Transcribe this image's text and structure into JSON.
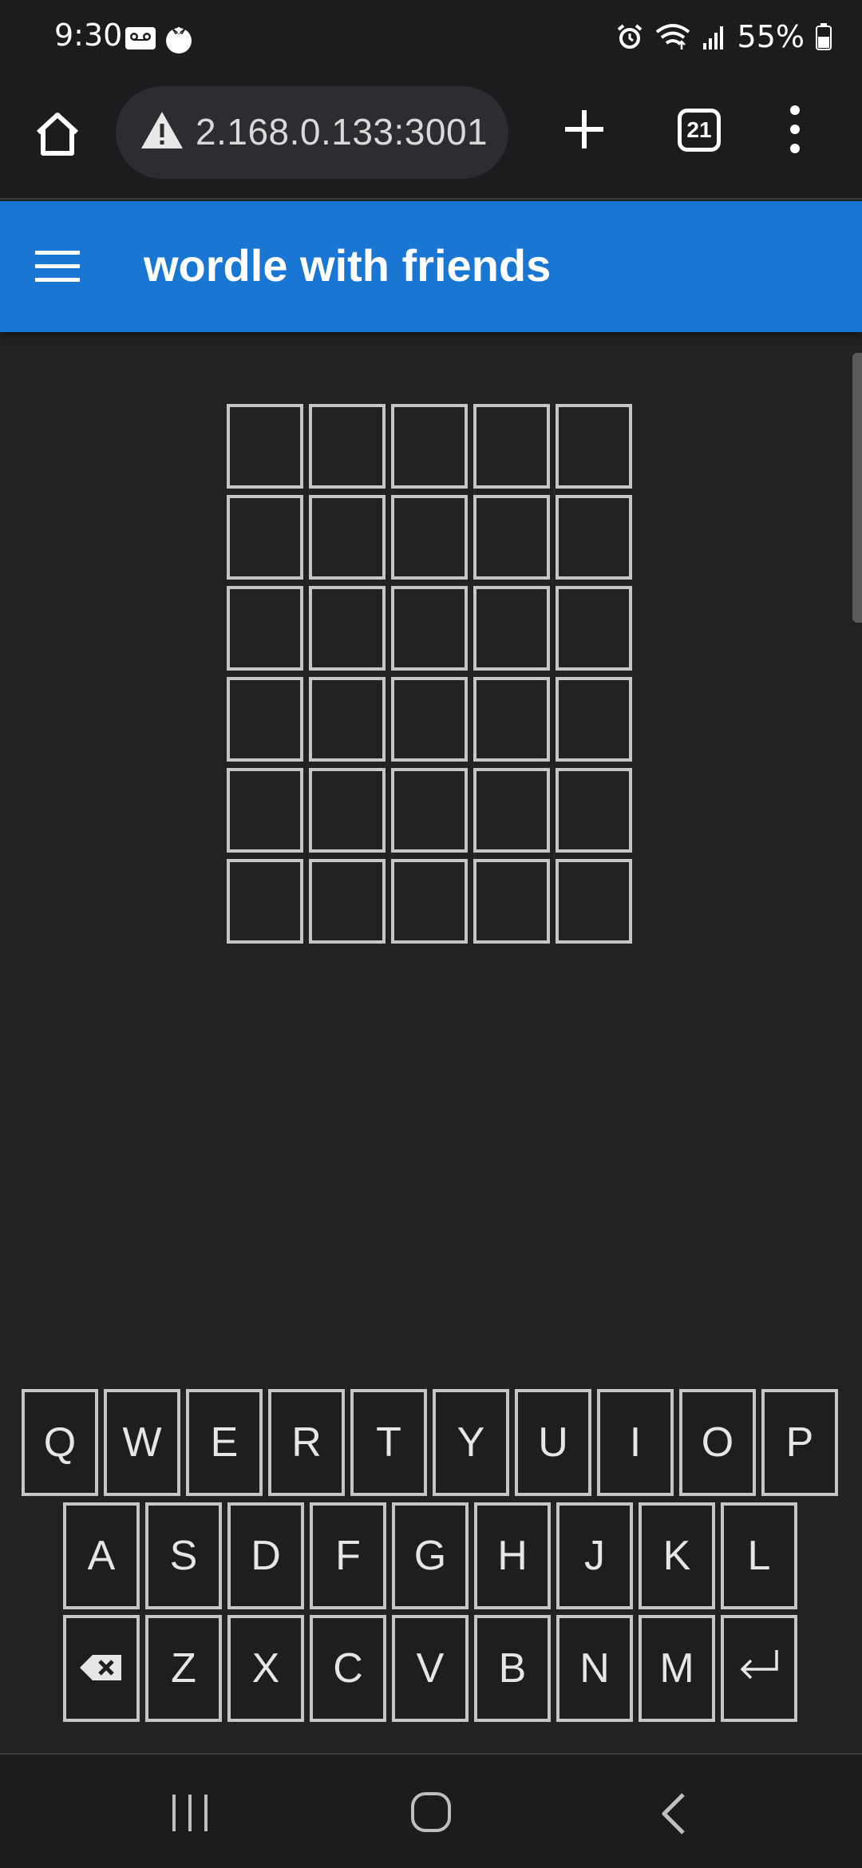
{
  "status_bar": {
    "time": "9:30",
    "battery": "55%",
    "left_icons": [
      "voicemail-icon",
      "tomato-app-icon"
    ],
    "right_icons": [
      "alarm-icon",
      "wifi-icon",
      "signal-icon",
      "battery-icon"
    ]
  },
  "browser": {
    "url": "2.168.0.133:3001",
    "tab_count": "21",
    "icons": [
      "home-icon",
      "warning-icon",
      "plus-icon",
      "tabs-icon",
      "more-vert-icon"
    ]
  },
  "app": {
    "title": "wordle with friends",
    "menu_icon": "hamburger-menu-icon",
    "header_color": "#1976d2"
  },
  "board": {
    "rows": [
      [
        "",
        "",
        "",
        "",
        ""
      ],
      [
        "",
        "",
        "",
        "",
        ""
      ],
      [
        "",
        "",
        "",
        "",
        ""
      ],
      [
        "",
        "",
        "",
        "",
        ""
      ],
      [
        "",
        "",
        "",
        "",
        ""
      ],
      [
        "",
        "",
        "",
        "",
        ""
      ]
    ]
  },
  "keyboard": {
    "row1": [
      "Q",
      "W",
      "E",
      "R",
      "T",
      "Y",
      "U",
      "I",
      "O",
      "P"
    ],
    "row2": [
      "A",
      "S",
      "D",
      "F",
      "G",
      "H",
      "J",
      "K",
      "L"
    ],
    "row3": [
      "backspace-icon",
      "Z",
      "X",
      "C",
      "V",
      "B",
      "N",
      "M",
      "enter-icon"
    ]
  },
  "nav_bar": {
    "icons": [
      "recent-apps-icon",
      "home-circle-icon",
      "back-icon"
    ]
  },
  "colors": {
    "background": "#222222",
    "tile_border": "#c6c6c6",
    "chrome": "#1b1c1e"
  }
}
